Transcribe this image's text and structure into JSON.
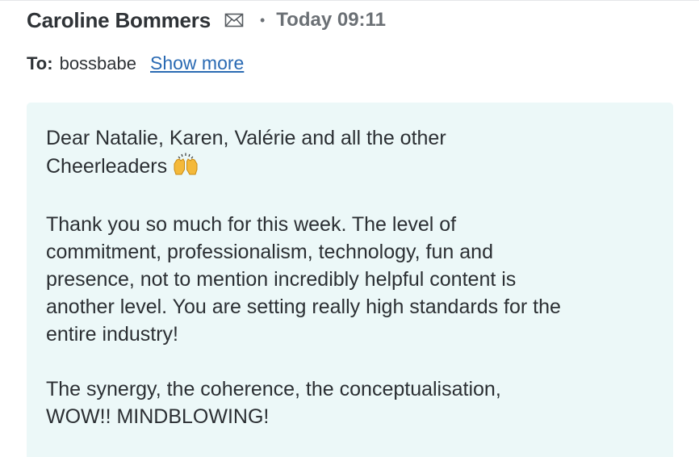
{
  "header": {
    "sender_name": "Caroline Bommers",
    "separator": "•",
    "timestamp": "Today 09:11",
    "mail_icon": "envelope-icon"
  },
  "recipients": {
    "label": "To:",
    "value": "bossbabe",
    "show_more": "Show more"
  },
  "message": {
    "greeting_line1": "Dear Natalie, Karen, Valérie and all the other",
    "greeting_line2": "Cheerleaders",
    "greeting_emoji": "raising-hands-emoji",
    "paragraph1": "Thank you so much for this week. The level of\ncommitment, professionalism, technology, fun and\npresence, not to mention incredibly helpful content is\nanother level. You are setting really high standards for the\nentire industry!",
    "paragraph2": "The synergy, the coherence, the conceptualisation,\nWOW!! MINDBLOWING!"
  },
  "colors": {
    "message_background": "#ecf8f8",
    "link": "#2a6ab3",
    "muted_text": "#6b7075",
    "text": "#2b2f33"
  }
}
